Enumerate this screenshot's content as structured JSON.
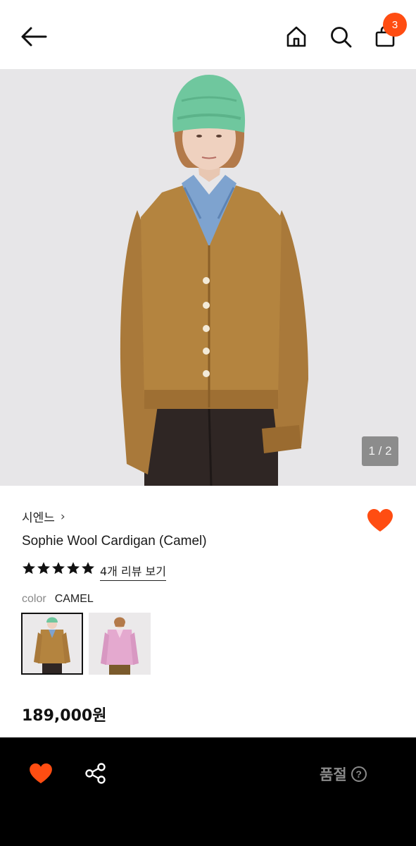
{
  "header": {
    "cart_count": "3"
  },
  "hero": {
    "counter": "1 / 2"
  },
  "product": {
    "brand": "시엔느",
    "brand_chevron": "›",
    "title": "Sophie Wool Cardigan (Camel)",
    "rating_stars": 5,
    "review_link": "4개 리뷰 보기",
    "color_label": "color",
    "color_value": "CAMEL",
    "price": "189,000원"
  },
  "bottom_bar": {
    "status": "품절",
    "help": "?"
  },
  "colors": {
    "accent": "#ff4d12",
    "bar_bg": "#000000",
    "muted": "#8a8a8a"
  },
  "icons": [
    "arrow-left-icon",
    "home-icon",
    "search-icon",
    "shopping-bag-icon",
    "heart-icon",
    "share-icon",
    "question-icon",
    "star-icon"
  ]
}
